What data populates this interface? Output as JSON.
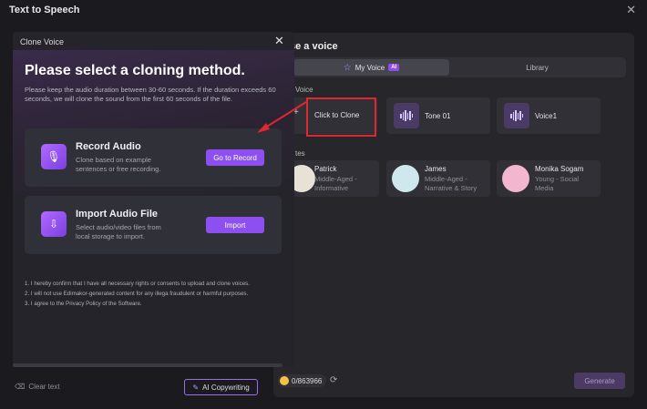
{
  "app": {
    "title": "Text to Speech",
    "close_symbol": "✕"
  },
  "right_panel": {
    "title": "se a voice",
    "tabs": [
      {
        "label": "My Voice",
        "badge": "AI"
      },
      {
        "label": "Library"
      }
    ],
    "my_voice_label": "Voice",
    "voices": [
      {
        "label": "Click to Clone"
      },
      {
        "label": "Tone 01"
      },
      {
        "label": "Voice1"
      }
    ],
    "favorites_label": "tes",
    "presets": [
      {
        "name": "Patrick",
        "desc": "Middle-Aged - Informative"
      },
      {
        "name": "James",
        "desc": "Middle-Aged - Narrative & Story"
      },
      {
        "name": "Monika Sogam",
        "desc": "Young - Social Media"
      }
    ],
    "credits": "0/863966",
    "generate_label": "Generate"
  },
  "editor": {
    "clear_text": "Clear text",
    "ai_copywriting": "AI Copywriting"
  },
  "modal": {
    "title": "Clone Voice",
    "heading": "Please select a cloning method.",
    "description": "Please keep the audio duration between 30-60 seconds. If the duration exceeds 60 seconds, we will clone the sound from the first 60 seconds of the file.",
    "options": [
      {
        "title": "Record Audio",
        "desc": "Clone based on example sentences or free recording.",
        "button": "Go to Record"
      },
      {
        "title": "Import Audio File",
        "desc": "Select audio/video files from local storage to import.",
        "button": "Import"
      }
    ],
    "terms": [
      "1. I hereby confirm that I have all necessary rights or consents to upload and clone voices.",
      "2. I will not use Edimakor-generated content for any illega fraudulent or harmful purposes.",
      "3. I agree to the Privacy Policy of the Software."
    ]
  },
  "colors": {
    "accent": "#8d4ff0",
    "highlight": "#e0262f",
    "background": "#1b1b1f"
  }
}
